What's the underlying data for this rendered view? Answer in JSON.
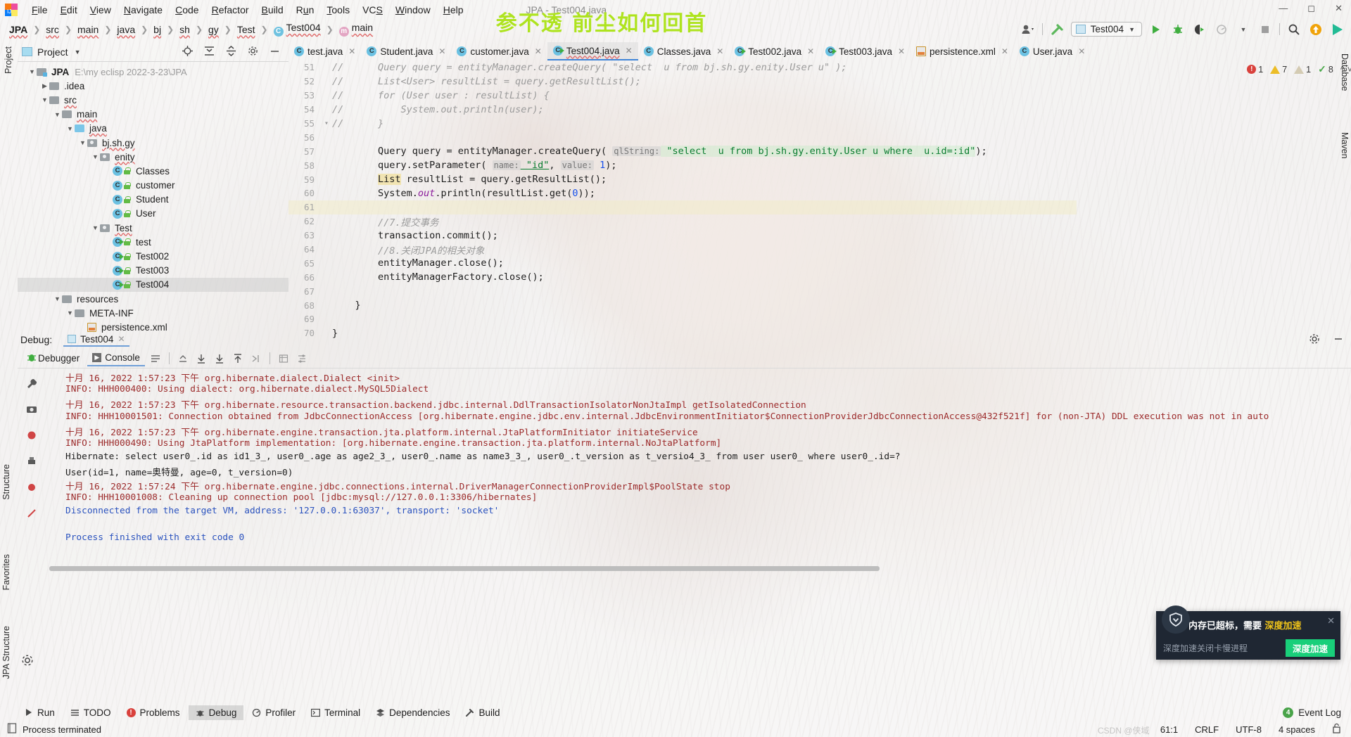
{
  "window": {
    "title": "JPA - Test004.java",
    "controls": [
      "minimize",
      "maximize",
      "close"
    ]
  },
  "overlay_text": "参不透 前尘如何回首",
  "menu": {
    "items": [
      "File",
      "Edit",
      "View",
      "Navigate",
      "Code",
      "Refactor",
      "Build",
      "Run",
      "Tools",
      "VCS",
      "Window",
      "Help"
    ]
  },
  "breadcrumb": {
    "items": [
      {
        "label": "JPA",
        "icon": ""
      },
      {
        "label": "src",
        "icon": ""
      },
      {
        "label": "main",
        "icon": ""
      },
      {
        "label": "java",
        "icon": ""
      },
      {
        "label": "bj",
        "icon": ""
      },
      {
        "label": "sh",
        "icon": ""
      },
      {
        "label": "gy",
        "icon": ""
      },
      {
        "label": "Test",
        "icon": ""
      },
      {
        "label": "Test004",
        "icon": "class-icon"
      },
      {
        "label": "main",
        "icon": "method-icon"
      }
    ]
  },
  "toolbar": {
    "run_config": "Test004",
    "actions": [
      "run-icon",
      "debug-icon",
      "run-coverage-icon",
      "profiler-icon",
      "stop-icon",
      "search-icon",
      "update-icon",
      "ide-icon"
    ],
    "account_icon": "account-icon",
    "build_icon": "build-hammer-icon"
  },
  "project": {
    "title": "Project",
    "header_actions": [
      "locate-icon",
      "expand-all-icon",
      "collapse-all-icon",
      "settings-icon",
      "hide-icon"
    ],
    "tree": [
      {
        "depth": 0,
        "label": "JPA",
        "path": "E:\\my eclisp 2022-3-23\\JPA",
        "kind": "project",
        "arrow": "open",
        "bold": true
      },
      {
        "depth": 1,
        "label": ".idea",
        "path": "",
        "kind": "folder",
        "arrow": "closed",
        "bold": false
      },
      {
        "depth": 1,
        "label": "src",
        "path": "",
        "kind": "folder",
        "arrow": "open",
        "bold": false
      },
      {
        "depth": 2,
        "label": "main",
        "path": "",
        "kind": "folder",
        "arrow": "open",
        "bold": false
      },
      {
        "depth": 3,
        "label": "java",
        "path": "",
        "kind": "source",
        "arrow": "open",
        "bold": false
      },
      {
        "depth": 4,
        "label": "bj.sh.gy",
        "path": "",
        "kind": "package",
        "arrow": "open",
        "bold": false
      },
      {
        "depth": 5,
        "label": "enity",
        "path": "",
        "kind": "package",
        "arrow": "open",
        "bold": false
      },
      {
        "depth": 6,
        "label": "Classes",
        "path": "",
        "kind": "class",
        "arrow": "none",
        "bold": false
      },
      {
        "depth": 6,
        "label": "customer",
        "path": "",
        "kind": "class",
        "arrow": "none",
        "bold": false
      },
      {
        "depth": 6,
        "label": "Student",
        "path": "",
        "kind": "class",
        "arrow": "none",
        "bold": false
      },
      {
        "depth": 6,
        "label": "User",
        "path": "",
        "kind": "class",
        "arrow": "none",
        "bold": false
      },
      {
        "depth": 5,
        "label": "Test",
        "path": "",
        "kind": "package",
        "arrow": "open",
        "bold": false
      },
      {
        "depth": 6,
        "label": "test",
        "path": "",
        "kind": "runnable-class",
        "arrow": "none",
        "bold": false
      },
      {
        "depth": 6,
        "label": "Test002",
        "path": "",
        "kind": "runnable-class",
        "arrow": "none",
        "bold": false
      },
      {
        "depth": 6,
        "label": "Test003",
        "path": "",
        "kind": "runnable-class",
        "arrow": "none",
        "bold": false
      },
      {
        "depth": 6,
        "label": "Test004",
        "path": "",
        "kind": "runnable-class",
        "arrow": "none",
        "bold": false,
        "selected": true
      },
      {
        "depth": 3,
        "label": "resources",
        "path": "",
        "kind": "folder",
        "arrow": "open",
        "bold": false
      },
      {
        "depth": 4,
        "label": "META-INF",
        "path": "",
        "kind": "folder",
        "arrow": "open",
        "bold": false
      },
      {
        "depth": 5,
        "label": "persistence.xml",
        "path": "",
        "kind": "xml",
        "arrow": "none",
        "bold": false
      }
    ]
  },
  "editor": {
    "tabs": [
      {
        "label": "test.java",
        "icon": "class-icon",
        "active": false,
        "wavy": false
      },
      {
        "label": "Student.java",
        "icon": "class-icon",
        "active": false,
        "wavy": false
      },
      {
        "label": "customer.java",
        "icon": "class-icon",
        "active": false,
        "wavy": false
      },
      {
        "label": "Test004.java",
        "icon": "runnable-class-icon",
        "active": true,
        "wavy": true
      },
      {
        "label": "Classes.java",
        "icon": "class-icon",
        "active": false,
        "wavy": false
      },
      {
        "label": "Test002.java",
        "icon": "runnable-class-icon",
        "active": false,
        "wavy": false
      },
      {
        "label": "Test003.java",
        "icon": "runnable-class-icon",
        "active": false,
        "wavy": false
      },
      {
        "label": "persistence.xml",
        "icon": "xml-icon",
        "active": false,
        "wavy": false
      },
      {
        "label": "User.java",
        "icon": "class-icon",
        "active": false,
        "wavy": false
      }
    ],
    "inspections": {
      "errors": "1",
      "warnings": "7",
      "weak_warnings": "1",
      "checks": "8"
    },
    "lines": [
      {
        "no": "51",
        "text": "//      Query query = entityManager.createQuery( qlString: \"select  u from bj.sh.gy.enity.User u\" );",
        "type": "comment",
        "clipped": true
      },
      {
        "no": "52",
        "text": "//      List<User> resultList = query.getResultList();",
        "type": "comment"
      },
      {
        "no": "53",
        "text": "//      for (User user : resultList) {",
        "type": "comment"
      },
      {
        "no": "54",
        "text": "//          System.out.println(user);",
        "type": "comment"
      },
      {
        "no": "55",
        "text": "//      }",
        "type": "comment",
        "fold": true
      },
      {
        "no": "56",
        "text": "",
        "type": "blank"
      },
      {
        "no": "57",
        "text": "Query query = entityManager.createQuery( qlString: \"select  u from bj.sh.gy.enity.User u where  u.id=:id\");",
        "type": "code-query"
      },
      {
        "no": "58",
        "text": "query.setParameter( name: \"id\", value: 1);",
        "type": "code-param"
      },
      {
        "no": "59",
        "text": "List resultList = query.getResultList();",
        "type": "code-list"
      },
      {
        "no": "60",
        "text": "System.out.println(resultList.get(0));",
        "type": "code-println"
      },
      {
        "no": "61",
        "text": "",
        "type": "blank",
        "current": true
      },
      {
        "no": "62",
        "text": "//7.提交事务",
        "type": "comment"
      },
      {
        "no": "63",
        "text": "transaction.commit();",
        "type": "plain"
      },
      {
        "no": "64",
        "text": "//8.关闭JPA的相关对象",
        "type": "comment"
      },
      {
        "no": "65",
        "text": "entityManager.close();",
        "type": "plain"
      },
      {
        "no": "66",
        "text": "entityManagerFactory.close();",
        "type": "plain"
      },
      {
        "no": "67",
        "text": "",
        "type": "blank"
      },
      {
        "no": "68",
        "text": "}",
        "type": "plain-brace1"
      },
      {
        "no": "69",
        "text": "",
        "type": "blank"
      },
      {
        "no": "70",
        "text": "}",
        "type": "plain-brace0"
      }
    ]
  },
  "debug": {
    "label": "Debug:",
    "session_tab": "Test004",
    "tabs": [
      {
        "label": "Debugger",
        "active": false
      },
      {
        "label": "Console",
        "active": true
      }
    ],
    "console_buttons": [
      "wrap-icon",
      "up-stack-icon",
      "step-down-icon",
      "step-into-icon",
      "step-out-icon",
      "run-to-cursor-icon",
      "table-icon",
      "filter-icon"
    ],
    "head_actions": [
      "settings-icon",
      "minimize-icon"
    ],
    "side_icons": [
      "bug-icon",
      "wrench-icon",
      "camera-icon",
      "mute-icon",
      "print-icon",
      "record-icon",
      "strike-icon"
    ],
    "console_lines": [
      {
        "text": "十月 16, 2022 1:57:23 下午 org.hibernate.dialect.Dialect <init>",
        "color": "red"
      },
      {
        "text": "INFO: HHH000400: Using dialect: org.hibernate.dialect.MySQL5Dialect",
        "color": "red"
      },
      {
        "text": "十月 16, 2022 1:57:23 下午 org.hibernate.resource.transaction.backend.jdbc.internal.DdlTransactionIsolatorNonJtaImpl getIsolatedConnection",
        "color": "red"
      },
      {
        "text": "INFO: HHH10001501: Connection obtained from JdbcConnectionAccess [org.hibernate.engine.jdbc.env.internal.JdbcEnvironmentInitiator$ConnectionProviderJdbcConnectionAccess@432f521f] for (non-JTA) DDL execution was not in auto",
        "color": "red"
      },
      {
        "text": "十月 16, 2022 1:57:23 下午 org.hibernate.engine.transaction.jta.platform.internal.JtaPlatformInitiator initiateService",
        "color": "red"
      },
      {
        "text": "INFO: HHH000490: Using JtaPlatform implementation: [org.hibernate.engine.transaction.jta.platform.internal.NoJtaPlatform]",
        "color": "red"
      },
      {
        "text": "Hibernate: select user0_.id as id1_3_, user0_.age as age2_3_, user0_.name as name3_3_, user0_.t_version as t_versio4_3_ from user user0_ where user0_.id=?",
        "color": "black"
      },
      {
        "text": "User(id=1, name=奥特曼, age=0, t_version=0)",
        "color": "black"
      },
      {
        "text": "十月 16, 2022 1:57:24 下午 org.hibernate.engine.jdbc.connections.internal.DriverManagerConnectionProviderImpl$PoolState stop",
        "color": "red"
      },
      {
        "text": "INFO: HHH10001008: Cleaning up connection pool [jdbc:mysql://127.0.0.1:3306/hibernates]",
        "color": "red"
      },
      {
        "text": "Disconnected from the target VM, address: '127.0.0.1:63037', transport: 'socket'",
        "color": "blue"
      },
      {
        "text": "",
        "color": "black"
      },
      {
        "text": "Process finished with exit code 0",
        "color": "blue"
      }
    ]
  },
  "left_tool_bar": [
    "Project",
    "Structure",
    "Favorites",
    "JPA Structure"
  ],
  "right_tool_bar": [
    "Database",
    "Maven"
  ],
  "bottom_tool_bar": {
    "items": [
      {
        "label": "Run",
        "icon": "run-icon",
        "active": false
      },
      {
        "label": "TODO",
        "icon": "todo-icon",
        "active": false
      },
      {
        "label": "Problems",
        "icon": "problems-icon",
        "active": false
      },
      {
        "label": "Debug",
        "icon": "debug-icon",
        "active": true
      },
      {
        "label": "Profiler",
        "icon": "profiler-icon",
        "active": false
      },
      {
        "label": "Terminal",
        "icon": "terminal-icon",
        "active": false
      },
      {
        "label": "Dependencies",
        "icon": "dependencies-icon",
        "active": false
      },
      {
        "label": "Build",
        "icon": "build-icon",
        "active": false
      }
    ],
    "event_log": {
      "label": "Event Log",
      "count": "4"
    }
  },
  "status_bar": {
    "message": "Process terminated",
    "caret": "61:1",
    "line_separator": "CRLF",
    "encoding": "UTF-8",
    "indent": "4 spaces",
    "lock_icon": "unlocked-icon"
  },
  "popup": {
    "title_prefix": "内存已超标，需要 ",
    "title_accent": "深度加速",
    "subtitle": "深度加速关闭卡慢进程",
    "cta": "深度加速",
    "close_icon": "close-icon",
    "shield_icon": "shield-icon",
    "accent_color": "#f0c419",
    "cta_color": "#19cf7a"
  },
  "watermark": "CSDN @侠域"
}
